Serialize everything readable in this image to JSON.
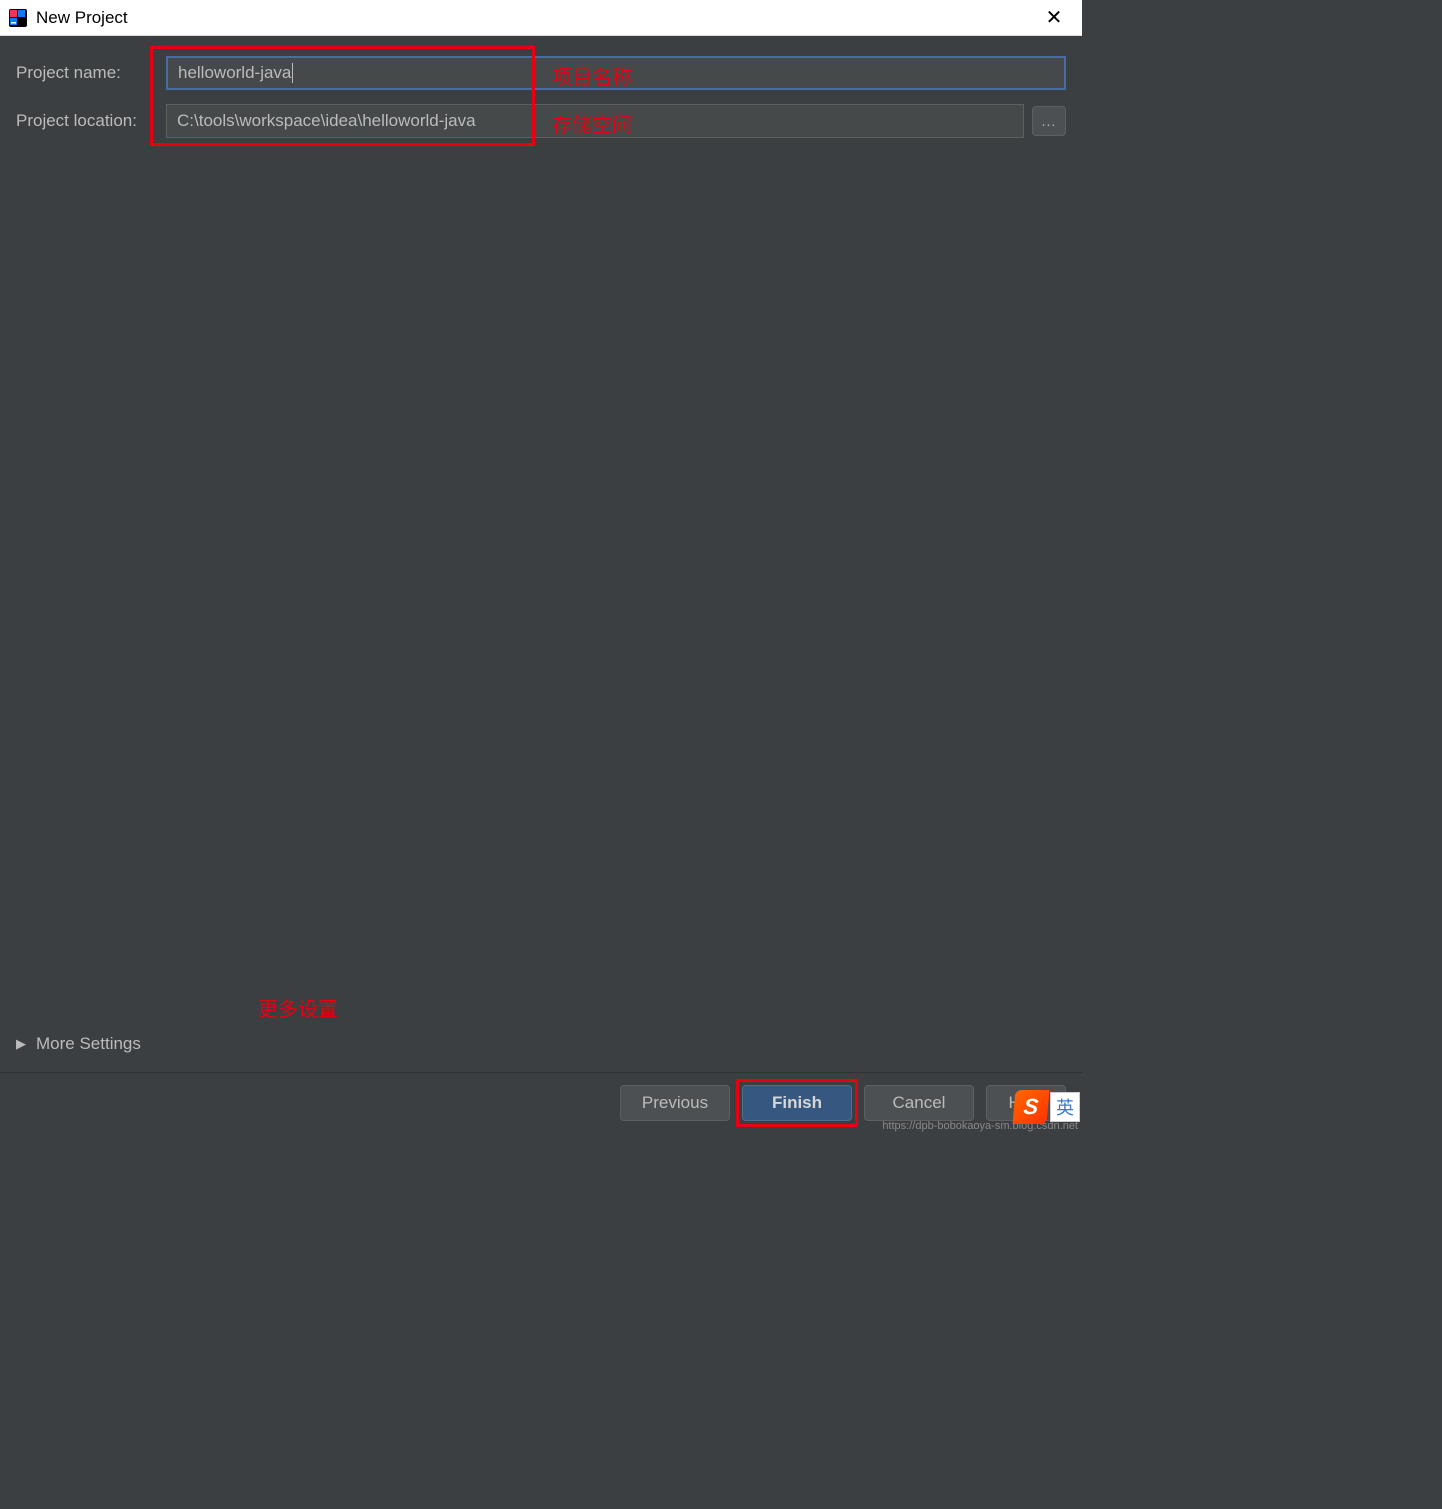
{
  "titlebar": {
    "title": "New Project",
    "close_icon": "✕"
  },
  "form": {
    "project_name_label": "Project name:",
    "project_name_value": "helloworld-java",
    "project_location_label": "Project location:",
    "project_location_value": "C:\\tools\\workspace\\idea\\helloworld-java",
    "browse_label": "..."
  },
  "annotations": {
    "project_name": "项目名称",
    "storage_space": "存储空间",
    "more_settings": "更多设置"
  },
  "more_settings": {
    "label": "More Settings",
    "arrow": "▶"
  },
  "buttons": {
    "previous": "Previous",
    "finish": "Finish",
    "cancel": "Cancel",
    "help": "Help"
  },
  "ime": {
    "logo": "S",
    "mode": "英"
  },
  "watermark": "https://dpb-bobokaoya-sm.blog.csdn.net"
}
